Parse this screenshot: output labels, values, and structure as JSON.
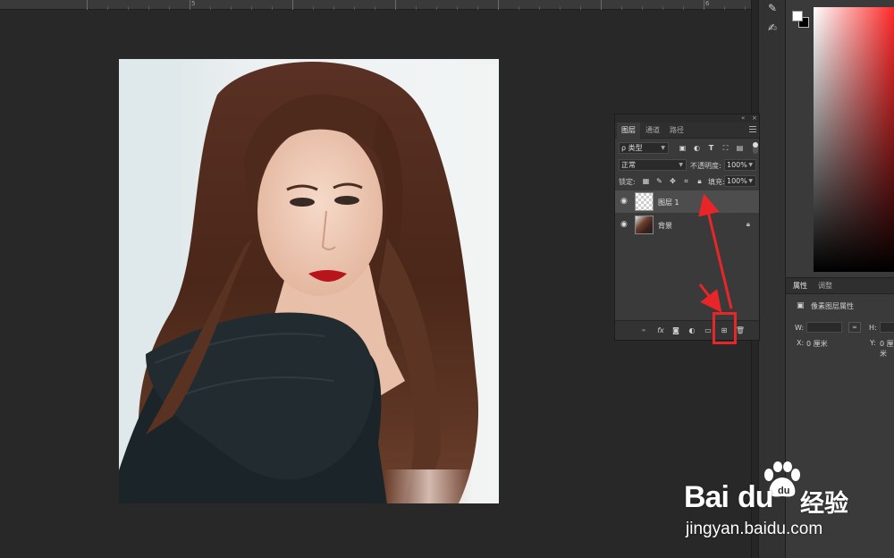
{
  "ruler": {
    "labels": [
      "5",
      "6"
    ]
  },
  "layers_panel": {
    "tabs": [
      "图层",
      "通道",
      "路径"
    ],
    "active_tab": 0,
    "filter_kind": "类型",
    "filter_prefix": "ρ",
    "blend_mode": "正常",
    "opacity_label": "不透明度:",
    "opacity_value": "100%",
    "lock_label": "锁定:",
    "fill_label": "填充:",
    "fill_value": "100%",
    "layers": [
      {
        "name": "图层 1",
        "selected": true,
        "thumb": "transparent"
      },
      {
        "name": "背景",
        "selected": false,
        "thumb": "photo",
        "locked": true
      }
    ],
    "bottom_icons": [
      "link-icon",
      "fx-icon",
      "mask-icon",
      "adjustment-icon",
      "folder-icon",
      "new-layer-icon",
      "trash-icon"
    ],
    "fx_label": "fx"
  },
  "properties_panel": {
    "tabs": [
      "属性",
      "调整"
    ],
    "active_tab": 0,
    "type_label": "像素图层属性",
    "w_label": "W:",
    "h_label": "H:",
    "x_label": "X:",
    "x_value": "0 厘米",
    "y_label": "Y:",
    "y_value": "0 厘米"
  },
  "colors": {
    "foreground": "#ffffff",
    "background": "#000000",
    "annotation": "#e8262a"
  },
  "watermark": {
    "brand_latin": "Bai",
    "brand_du": "du",
    "brand_cn": "经验",
    "url": "jingyan.baidu.com"
  }
}
